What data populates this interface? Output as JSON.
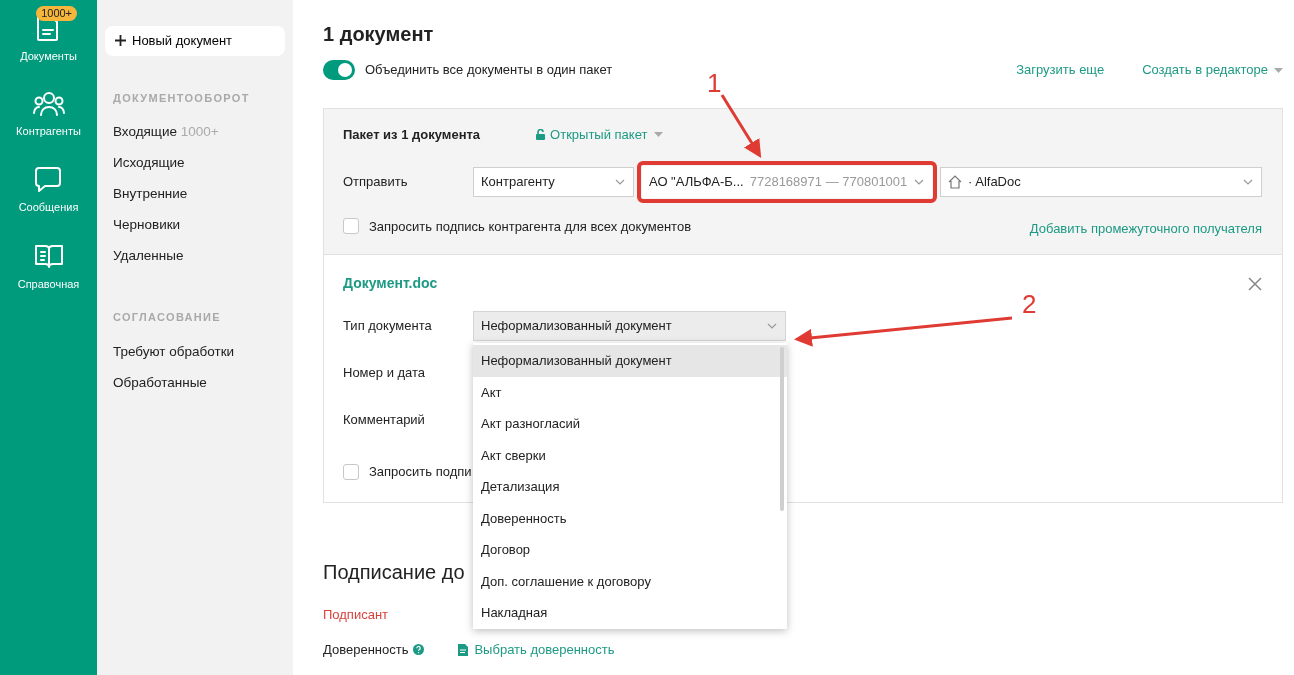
{
  "rail": {
    "items": [
      {
        "label": "Документы",
        "kind": "document",
        "badge": "1000+"
      },
      {
        "label": "Контрагенты",
        "kind": "people"
      },
      {
        "label": "Сообщения",
        "kind": "chat"
      },
      {
        "label": "Справочная",
        "kind": "book"
      }
    ]
  },
  "sidebar": {
    "new_button": "Новый документ",
    "sections": [
      {
        "title": "ДОКУМЕНТООБОРОТ",
        "items": [
          {
            "label": "Входящие",
            "count": "1000+"
          },
          {
            "label": "Исходящие"
          },
          {
            "label": "Внутренние"
          },
          {
            "label": "Черновики"
          },
          {
            "label": "Удаленные"
          }
        ]
      },
      {
        "title": "СОГЛАСОВАНИЕ",
        "items": [
          {
            "label": "Требуют обработки"
          },
          {
            "label": "Обработанные"
          }
        ]
      }
    ]
  },
  "main": {
    "title": "1 документ",
    "merge_toggle": {
      "label": "Объединить все документы в один пакет",
      "on": true
    },
    "links": [
      {
        "label": "Загрузить еще",
        "dropdown": false
      },
      {
        "label": "Создать в редакторе",
        "dropdown": true
      }
    ],
    "package": {
      "title": "Пакет из 1 документа",
      "access": "Открытый пакет",
      "send_label": "Отправить",
      "selects": [
        {
          "value": "Контрагенту",
          "kind": "plain"
        },
        {
          "value": "АО \"АЛЬФА-Б...",
          "hint": "7728168971 — 770801001",
          "kind": "highlighted"
        },
        {
          "value": "· AlfaDoc",
          "kind": "home"
        }
      ],
      "sign_request": {
        "label": "Запросить подпись контрагента для всех документов",
        "checked": false
      },
      "add_link": "Добавить промежуточного получателя"
    },
    "document": {
      "name": "Документ.doc",
      "fields": [
        {
          "label": "Тип документа",
          "value": "Неформализованный документ"
        },
        {
          "label": "Номер и дата"
        },
        {
          "label": "Комментарий"
        }
      ],
      "sign_request": {
        "label": "Запросить подпи",
        "checked": false
      },
      "type_menu": {
        "options": [
          {
            "label": "Неформализованный документ",
            "selected": true
          },
          {
            "label": "Акт",
            "selected": false
          },
          {
            "label": "Акт разногласий",
            "selected": false
          },
          {
            "label": "Акт сверки",
            "selected": false
          },
          {
            "label": "Детализация",
            "selected": false
          },
          {
            "label": "Доверенность",
            "selected": false
          },
          {
            "label": "Договор",
            "selected": false
          },
          {
            "label": "Доп. соглашение к договору",
            "selected": false
          },
          {
            "label": "Накладная",
            "selected": false
          }
        ]
      }
    },
    "signing": {
      "title": "Подписание до",
      "signer": "Подписант",
      "attorney_label": "Доверенность",
      "attorney_link": "Выбрать доверенность"
    }
  },
  "annotations": [
    {
      "label": "1"
    },
    {
      "label": "2"
    }
  ]
}
